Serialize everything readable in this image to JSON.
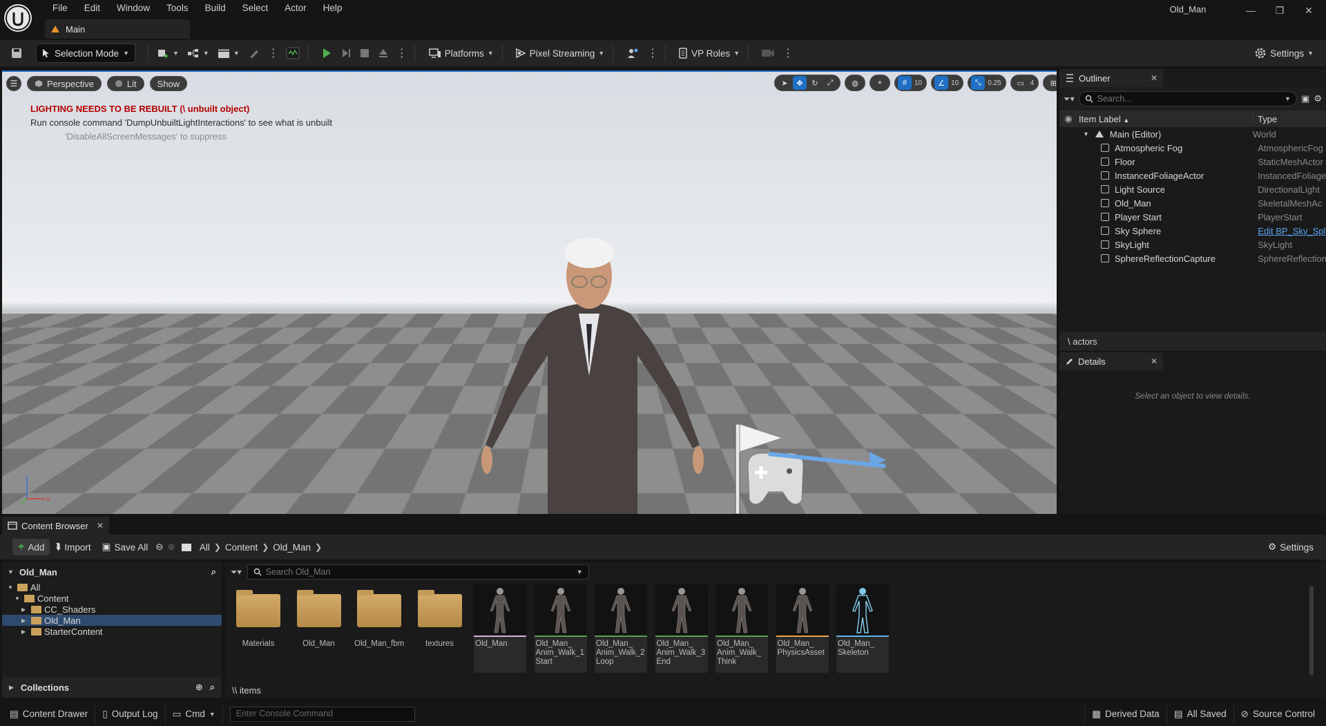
{
  "app": {
    "window_title": "Old_Man",
    "menu": [
      "File",
      "Edit",
      "Window",
      "Tools",
      "Build",
      "Select",
      "Actor",
      "Help"
    ],
    "document_tab": "Main"
  },
  "toolbar": {
    "selection_mode": "Selection Mode",
    "platforms": "Platforms",
    "pixel_streaming": "Pixel Streaming",
    "vp_roles": "VP Roles",
    "settings": "Settings"
  },
  "viewport": {
    "perspective": "Perspective",
    "lit": "Lit",
    "show": "Show",
    "warning_title": "LIGHTING NEEDS TO BE REBUILT (\\ unbuilt object)",
    "warning_line": "Run console command 'DumpUnbuiltLightInteractions' to see what is unbuilt",
    "warning_suppress": "'DisableAllScreenMessages' to suppress",
    "grid_snap": "10",
    "angle_snap": "10",
    "scale_snap": "0.25",
    "camera_speed": "4",
    "accent_color": "#1f6fc4",
    "warning_color": "#b40000"
  },
  "outliner": {
    "title": "Outliner",
    "search_placeholder": "Search...",
    "col_label": "Item Label",
    "col_type": "Type",
    "root": {
      "label": "Main (Editor)",
      "type": "World"
    },
    "items": [
      {
        "label": "Atmospheric Fog",
        "type": "AtmosphericFog",
        "icon": "fog-icon"
      },
      {
        "label": "Floor",
        "type": "StaticMeshActor",
        "icon": "static-mesh-icon"
      },
      {
        "label": "InstancedFoliageActor",
        "type": "InstancedFoliage",
        "icon": "foliage-icon"
      },
      {
        "label": "Light Source",
        "type": "DirectionalLight",
        "icon": "light-icon"
      },
      {
        "label": "Old_Man",
        "type": "SkeletalMeshAc",
        "icon": "skeletal-mesh-icon"
      },
      {
        "label": "Player Start",
        "type": "PlayerStart",
        "icon": "player-start-icon"
      },
      {
        "label": "Sky Sphere",
        "type": "Edit BP_Sky_Spl",
        "icon": "sky-sphere-icon",
        "link": true
      },
      {
        "label": "SkyLight",
        "type": "SkyLight",
        "icon": "skylight-icon"
      },
      {
        "label": "SphereReflectionCapture",
        "type": "SphereReflection",
        "icon": "reflection-icon"
      }
    ],
    "footer": "\\ actors"
  },
  "details": {
    "title": "Details",
    "empty_text": "Select an object to view details."
  },
  "content_browser": {
    "tab": "Content Browser",
    "add": "Add",
    "import": "Import",
    "save_all": "Save All",
    "breadcrumbs": [
      "All",
      "Content",
      "Old_Man"
    ],
    "settings": "Settings",
    "tree_title": "Old_Man",
    "tree": [
      {
        "label": "All",
        "depth": 0
      },
      {
        "label": "Content",
        "depth": 1
      },
      {
        "label": "CC_Shaders",
        "depth": 2
      },
      {
        "label": "Old_Man",
        "depth": 2,
        "selected": true
      },
      {
        "label": "StarterContent",
        "depth": 2
      }
    ],
    "collections": "Collections",
    "search_placeholder": "Search Old_Man",
    "assets": [
      {
        "name": "Materials",
        "kind": "folder"
      },
      {
        "name": "Old_Man",
        "kind": "folder"
      },
      {
        "name": "Old_Man_fbm",
        "kind": "folder"
      },
      {
        "name": "textures",
        "kind": "folder"
      },
      {
        "name": "Old_Man",
        "kind": "skeletal-mesh",
        "bar": "#d8b1e6"
      },
      {
        "name": "Old_Man_ Anim_Walk_1 Start",
        "kind": "animation",
        "bar": "#5aa35a"
      },
      {
        "name": "Old_Man_ Anim_Walk_2 Loop",
        "kind": "animation",
        "bar": "#5aa35a"
      },
      {
        "name": "Old_Man_ Anim_Walk_3 End",
        "kind": "animation",
        "bar": "#5aa35a"
      },
      {
        "name": "Old_Man_ Anim_Walk_ Think",
        "kind": "animation",
        "bar": "#5aa35a"
      },
      {
        "name": "Old_Man_ PhysicsAsset",
        "kind": "physics-asset",
        "bar": "#e8a64a"
      },
      {
        "name": "Old_Man_ Skeleton",
        "kind": "skeleton",
        "bar": "#5bb8e6"
      }
    ],
    "items_count": "\\\\ items"
  },
  "statusbar": {
    "content_drawer": "Content Drawer",
    "output_log": "Output Log",
    "cmd": "Cmd",
    "console_placeholder": "Enter Console Command",
    "derived_data": "Derived Data",
    "all_saved": "All Saved",
    "source_control": "Source Control"
  }
}
